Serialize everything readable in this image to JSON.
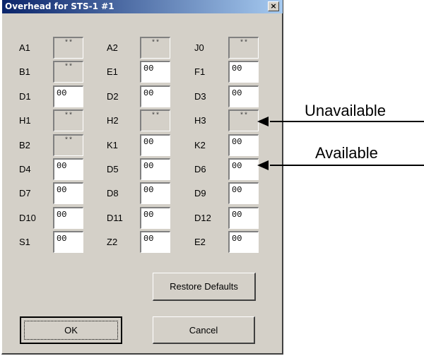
{
  "dialog": {
    "title": "Overhead for STS-1 #1",
    "close_glyph": "×",
    "rows": [
      [
        {
          "label": "A1",
          "value": "**",
          "available": false
        },
        {
          "label": "A2",
          "value": "**",
          "available": false
        },
        {
          "label": "J0",
          "value": "**",
          "available": false
        }
      ],
      [
        {
          "label": "B1",
          "value": "**",
          "available": false
        },
        {
          "label": "E1",
          "value": "00",
          "available": true
        },
        {
          "label": "F1",
          "value": "00",
          "available": true
        }
      ],
      [
        {
          "label": "D1",
          "value": "00",
          "available": true
        },
        {
          "label": "D2",
          "value": "00",
          "available": true
        },
        {
          "label": "D3",
          "value": "00",
          "available": true
        }
      ],
      [
        {
          "label": "H1",
          "value": "**",
          "available": false
        },
        {
          "label": "H2",
          "value": "**",
          "available": false
        },
        {
          "label": "H3",
          "value": "**",
          "available": false
        }
      ],
      [
        {
          "label": "B2",
          "value": "**",
          "available": false
        },
        {
          "label": "K1",
          "value": "00",
          "available": true
        },
        {
          "label": "K2",
          "value": "00",
          "available": true
        }
      ],
      [
        {
          "label": "D4",
          "value": "00",
          "available": true
        },
        {
          "label": "D5",
          "value": "00",
          "available": true
        },
        {
          "label": "D6",
          "value": "00",
          "available": true
        }
      ],
      [
        {
          "label": "D7",
          "value": "00",
          "available": true
        },
        {
          "label": "D8",
          "value": "00",
          "available": true
        },
        {
          "label": "D9",
          "value": "00",
          "available": true
        }
      ],
      [
        {
          "label": "D10",
          "value": "00",
          "available": true
        },
        {
          "label": "D11",
          "value": "00",
          "available": true
        },
        {
          "label": "D12",
          "value": "00",
          "available": true
        }
      ],
      [
        {
          "label": "S1",
          "value": "00",
          "available": true
        },
        {
          "label": "Z2",
          "value": "00",
          "available": true
        },
        {
          "label": "E2",
          "value": "00",
          "available": true
        }
      ]
    ],
    "restore_label": "Restore Defaults",
    "ok_label": "OK",
    "cancel_label": "Cancel"
  },
  "annotations": {
    "unavailable": "Unavailable",
    "available": "Available"
  },
  "colors": {
    "dialog_bg": "#d4d0c8",
    "title_gradient_start": "#0a246a",
    "title_gradient_end": "#a6caf0",
    "available_field": "#ffffff",
    "unavailable_field": "#d4d0c8"
  }
}
